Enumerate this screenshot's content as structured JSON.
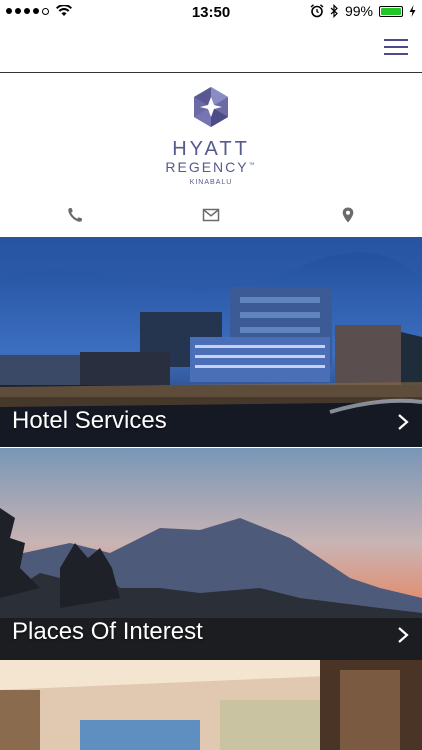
{
  "status_bar": {
    "time": "13:50",
    "battery_percent": "99%",
    "signal_bars_filled": 4,
    "signal_bars_total": 5
  },
  "logo": {
    "brand": "HYATT",
    "sub_brand": "REGENCY",
    "trademark": "™",
    "city": "KINABALU"
  },
  "actions": {
    "phone_icon": "phone-icon",
    "mail_icon": "mail-icon",
    "location_icon": "location-pin-icon"
  },
  "tiles": [
    {
      "label": "Hotel Services"
    },
    {
      "label": "Places Of Interest"
    }
  ],
  "colors": {
    "brand_purple": "#555a8f",
    "menu_icon": "#4d4a8a",
    "battery": "#21c728"
  }
}
